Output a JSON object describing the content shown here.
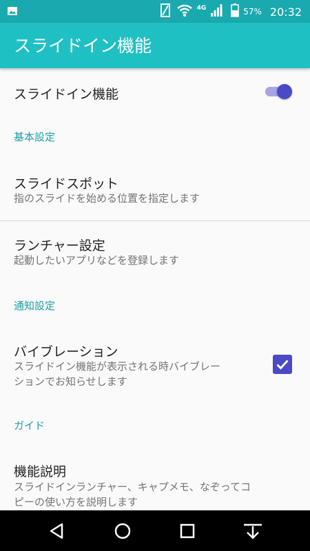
{
  "status_bar": {
    "network_type": "4G",
    "battery_percent": "57%",
    "time": "20:32",
    "icons": [
      "image-notification-icon",
      "phone-signal-icon",
      "wifi-icon",
      "cell-signal-icon",
      "battery-icon"
    ]
  },
  "app_bar": {
    "title": "スライドイン機能"
  },
  "master_toggle": {
    "label": "スライドイン機能",
    "enabled": true
  },
  "sections": {
    "basic": "基本設定",
    "notification": "通知設定",
    "guide": "ガイド"
  },
  "items": {
    "slide_spot": {
      "title": "スライドスポット",
      "summary": "指のスライドを始める位置を指定します"
    },
    "launcher": {
      "title": "ランチャー設定",
      "summary": "起動したいアプリなどを登録します"
    },
    "vibration": {
      "title": "バイブレーション",
      "summary_line1": "スライドイン機能が表示される時バイブレー",
      "summary_line2": "ションでお知らせします",
      "checked": true
    },
    "help": {
      "title": "機能説明",
      "summary_line1": "スライドインランチャー、キャプメモ、なぞってコ",
      "summary_line2": "ピーの使い方を説明します"
    }
  },
  "nav_bar": {
    "buttons": [
      "back-icon",
      "home-icon",
      "recents-icon",
      "notification-pull-icon"
    ]
  },
  "colors": {
    "status_bar": "#1aa9ae",
    "app_bar": "#1fc0c4",
    "accent": "#4a49c6",
    "section_header": "#1aa0a6"
  }
}
